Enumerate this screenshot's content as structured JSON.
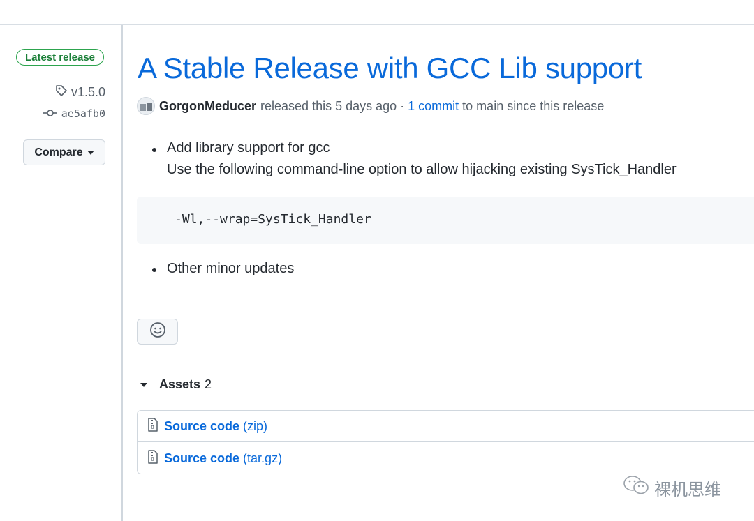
{
  "sidebar": {
    "latest_badge": "Latest release",
    "tag": "v1.5.0",
    "commit": "ae5afb0",
    "compare_label": "Compare"
  },
  "release": {
    "title": "A Stable Release with GCC Lib support",
    "author": "GorgonMeducer",
    "released_text": "released this 5 days ago",
    "separator": "·",
    "commit_link": "1 commit",
    "commit_suffix": "to main since this release"
  },
  "notes": {
    "item1": "Add library support for gcc",
    "item1_detail": "Use the following command-line option to allow hijacking existing SysTick_Handler",
    "code": "-Wl,--wrap=SysTick_Handler",
    "item2": "Other minor updates"
  },
  "assets": {
    "label": "Assets",
    "count": "2",
    "items": [
      {
        "name": "Source code",
        "ext": "(zip)",
        "icon": "file-zip-icon"
      },
      {
        "name": "Source code",
        "ext": "(tar.gz)",
        "icon": "file-zip-icon"
      }
    ]
  },
  "watermark": {
    "text": "裸机思维",
    "icon": "wechat-icon"
  },
  "colors": {
    "link": "#0969da",
    "badge_green": "#1a7f37",
    "muted": "#57606a"
  }
}
